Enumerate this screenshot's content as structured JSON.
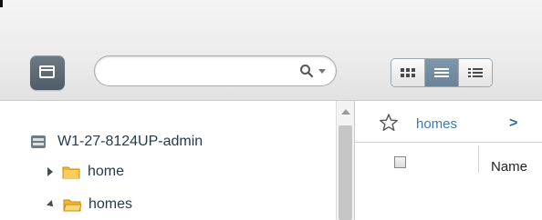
{
  "toolbar": {
    "search": {
      "value": "",
      "placeholder": ""
    },
    "view_buttons": [
      {
        "name": "thumbnail",
        "icon": "grid-icon",
        "active": false
      },
      {
        "name": "list",
        "icon": "list-icon",
        "active": true
      },
      {
        "name": "details",
        "icon": "detail-list-icon",
        "active": false
      }
    ]
  },
  "tree": {
    "server": "W1-27-8124UP-admin",
    "items": [
      {
        "label": "home",
        "expanded": false
      },
      {
        "label": "homes",
        "expanded": true
      }
    ]
  },
  "right": {
    "breadcrumb": "homes",
    "breadcrumb_separator": ">",
    "column_name": "Name"
  },
  "colors": {
    "accent": "#3d78b2",
    "active_view": "#7189a0",
    "folder": "#f2b533"
  }
}
